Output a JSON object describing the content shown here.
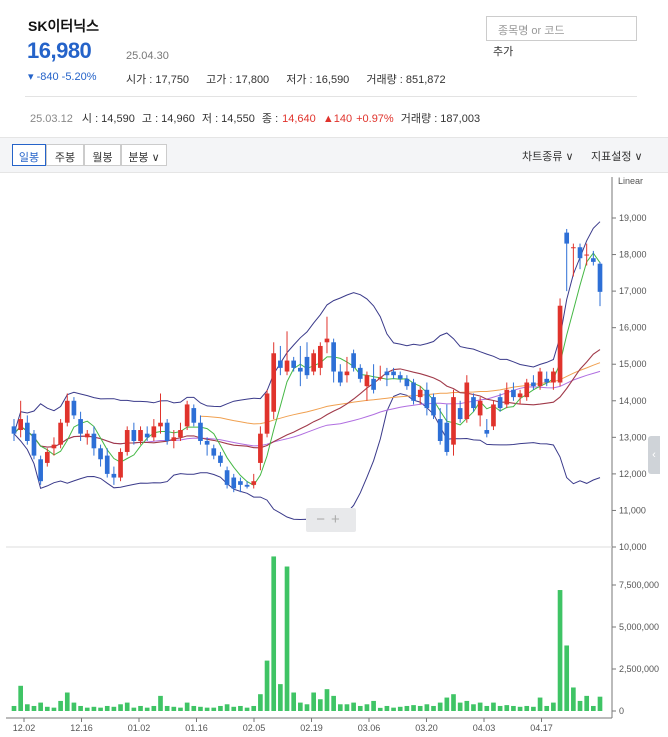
{
  "stock": {
    "name": "SK이터닉스",
    "price": "16,980",
    "change": "▾ -840  -5.20%",
    "date": "25.04.30",
    "open": "시가 : 17,750",
    "high": "고가 : 17,800",
    "low": "저가 : 16,590",
    "volume": "거래량 : 851,872"
  },
  "search": {
    "placeholder": "종목명 or 코드",
    "add_label": "추가"
  },
  "selected_day": {
    "date": "25.03.12",
    "open": "시 : 14,590",
    "high": "고 : 14,960",
    "low": "저 : 14,550",
    "close_label": "종 :",
    "close": "14,640",
    "change": "▲140",
    "change_pct": "+0.97%",
    "volume": "거래량 : 187,003"
  },
  "toolbar": {
    "tabs": [
      "일봉",
      "주봉",
      "월봉",
      "분봉 ∨"
    ],
    "chart_type": "차트종류 ∨",
    "indicators": "지표설정 ∨"
  },
  "colors": {
    "up": "#e0332c",
    "down": "#2d6fd6",
    "volume": "#3fc465",
    "bollinger": "#3a3a8a",
    "ma_short": "#45b845",
    "ma_mid": "#a03a4a",
    "ma_long": "#b06ee0",
    "ma_longest": "#f0a050"
  },
  "chart_data": {
    "type": "candlestick",
    "price_scale": "Linear",
    "y_ticks": [
      "19,000",
      "18,000",
      "17,000",
      "16,000",
      "15,000",
      "14,000",
      "13,000",
      "12,000",
      "11,000",
      "10,000"
    ],
    "volume_ticks": [
      "7,500,000",
      "5,000,000",
      "2,500,000",
      "0"
    ],
    "x_ticks": [
      "12.02",
      "12.16",
      "01.02",
      "01.16",
      "02.05",
      "02.19",
      "03.06",
      "03.20",
      "04.03",
      "04.17"
    ],
    "ylim": [
      10000,
      19500
    ],
    "candles": [
      {
        "o": 13300,
        "h": 13500,
        "l": 12900,
        "c": 13100,
        "v": 300000
      },
      {
        "o": 13200,
        "h": 14000,
        "l": 13000,
        "c": 13500,
        "v": 1500000
      },
      {
        "o": 13400,
        "h": 13600,
        "l": 12800,
        "c": 12900,
        "v": 400000
      },
      {
        "o": 13100,
        "h": 13200,
        "l": 12400,
        "c": 12500,
        "v": 300000
      },
      {
        "o": 12400,
        "h": 12500,
        "l": 11700,
        "c": 11800,
        "v": 500000
      },
      {
        "o": 12300,
        "h": 12700,
        "l": 12200,
        "c": 12600,
        "v": 250000
      },
      {
        "o": 12700,
        "h": 13000,
        "l": 12500,
        "c": 12800,
        "v": 200000
      },
      {
        "o": 12800,
        "h": 13500,
        "l": 12700,
        "c": 13400,
        "v": 600000
      },
      {
        "o": 13400,
        "h": 14200,
        "l": 13300,
        "c": 14000,
        "v": 1100000
      },
      {
        "o": 14000,
        "h": 14100,
        "l": 13500,
        "c": 13600,
        "v": 500000
      },
      {
        "o": 13500,
        "h": 13700,
        "l": 12900,
        "c": 13100,
        "v": 300000
      },
      {
        "o": 13000,
        "h": 13200,
        "l": 12800,
        "c": 13100,
        "v": 200000
      },
      {
        "o": 13100,
        "h": 13300,
        "l": 12500,
        "c": 12700,
        "v": 250000
      },
      {
        "o": 12700,
        "h": 12800,
        "l": 12200,
        "c": 12400,
        "v": 200000
      },
      {
        "o": 12500,
        "h": 12700,
        "l": 11900,
        "c": 12000,
        "v": 300000
      },
      {
        "o": 12000,
        "h": 12200,
        "l": 11700,
        "c": 11900,
        "v": 250000
      },
      {
        "o": 11900,
        "h": 12700,
        "l": 11800,
        "c": 12600,
        "v": 400000
      },
      {
        "o": 12600,
        "h": 13300,
        "l": 12500,
        "c": 13200,
        "v": 500000
      },
      {
        "o": 13200,
        "h": 13400,
        "l": 12800,
        "c": 12900,
        "v": 200000
      },
      {
        "o": 12900,
        "h": 13300,
        "l": 12800,
        "c": 13200,
        "v": 300000
      },
      {
        "o": 13100,
        "h": 13300,
        "l": 12900,
        "c": 13000,
        "v": 200000
      },
      {
        "o": 13000,
        "h": 13500,
        "l": 12900,
        "c": 13300,
        "v": 300000
      },
      {
        "o": 13300,
        "h": 14200,
        "l": 13100,
        "c": 13400,
        "v": 900000
      },
      {
        "o": 13400,
        "h": 13500,
        "l": 12800,
        "c": 12900,
        "v": 300000
      },
      {
        "o": 12900,
        "h": 13200,
        "l": 12700,
        "c": 13000,
        "v": 250000
      },
      {
        "o": 13000,
        "h": 13400,
        "l": 12900,
        "c": 13200,
        "v": 200000
      },
      {
        "o": 13300,
        "h": 14000,
        "l": 13200,
        "c": 13900,
        "v": 500000
      },
      {
        "o": 13800,
        "h": 13900,
        "l": 13300,
        "c": 13400,
        "v": 300000
      },
      {
        "o": 13400,
        "h": 13600,
        "l": 12800,
        "c": 12900,
        "v": 250000
      },
      {
        "o": 12900,
        "h": 13000,
        "l": 12500,
        "c": 12800,
        "v": 200000
      },
      {
        "o": 12700,
        "h": 12800,
        "l": 12400,
        "c": 12500,
        "v": 200000
      },
      {
        "o": 12500,
        "h": 12600,
        "l": 12200,
        "c": 12300,
        "v": 300000
      },
      {
        "o": 12100,
        "h": 12200,
        "l": 11600,
        "c": 11700,
        "v": 400000
      },
      {
        "o": 11900,
        "h": 12000,
        "l": 11500,
        "c": 11600,
        "v": 250000
      },
      {
        "o": 11800,
        "h": 11900,
        "l": 11500,
        "c": 11700,
        "v": 300000
      },
      {
        "o": 11700,
        "h": 11800,
        "l": 11600,
        "c": 11650,
        "v": 200000
      },
      {
        "o": 11700,
        "h": 12000,
        "l": 11600,
        "c": 11800,
        "v": 300000
      },
      {
        "o": 12300,
        "h": 13300,
        "l": 12100,
        "c": 13100,
        "v": 1000000
      },
      {
        "o": 13100,
        "h": 14300,
        "l": 13000,
        "c": 14200,
        "v": 3000000
      },
      {
        "o": 13700,
        "h": 15600,
        "l": 13500,
        "c": 15300,
        "v": 9200000
      },
      {
        "o": 15100,
        "h": 15500,
        "l": 14700,
        "c": 14900,
        "v": 1600000
      },
      {
        "o": 14800,
        "h": 15900,
        "l": 14700,
        "c": 15100,
        "v": 8600000
      },
      {
        "o": 15100,
        "h": 15200,
        "l": 14800,
        "c": 14900,
        "v": 1100000
      },
      {
        "o": 14900,
        "h": 15500,
        "l": 14400,
        "c": 14800,
        "v": 500000
      },
      {
        "o": 15200,
        "h": 15600,
        "l": 14600,
        "c": 14700,
        "v": 400000
      },
      {
        "o": 14800,
        "h": 15400,
        "l": 14700,
        "c": 15300,
        "v": 1100000
      },
      {
        "o": 14900,
        "h": 15600,
        "l": 14700,
        "c": 15500,
        "v": 700000
      },
      {
        "o": 15600,
        "h": 16300,
        "l": 15300,
        "c": 15700,
        "v": 1300000
      },
      {
        "o": 15600,
        "h": 15700,
        "l": 14500,
        "c": 14800,
        "v": 900000
      },
      {
        "o": 14800,
        "h": 15000,
        "l": 14400,
        "c": 14500,
        "v": 400000
      },
      {
        "o": 14700,
        "h": 15200,
        "l": 14500,
        "c": 14800,
        "v": 400000
      },
      {
        "o": 15300,
        "h": 15400,
        "l": 14800,
        "c": 14900,
        "v": 500000
      },
      {
        "o": 14900,
        "h": 15000,
        "l": 14500,
        "c": 14600,
        "v": 300000
      },
      {
        "o": 14400,
        "h": 14800,
        "l": 14000,
        "c": 14700,
        "v": 400000
      },
      {
        "o": 14600,
        "h": 15000,
        "l": 14200,
        "c": 14300,
        "v": 600000
      },
      {
        "o": 14600,
        "h": 14960,
        "l": 14550,
        "c": 14640,
        "v": 187003
      },
      {
        "o": 14800,
        "h": 14900,
        "l": 14400,
        "c": 14700,
        "v": 300000
      },
      {
        "o": 14800,
        "h": 14900,
        "l": 14600,
        "c": 14700,
        "v": 200000
      },
      {
        "o": 14700,
        "h": 14800,
        "l": 14500,
        "c": 14600,
        "v": 250000
      },
      {
        "o": 14600,
        "h": 14700,
        "l": 14300,
        "c": 14400,
        "v": 300000
      },
      {
        "o": 14500,
        "h": 14600,
        "l": 13900,
        "c": 14000,
        "v": 350000
      },
      {
        "o": 14100,
        "h": 14400,
        "l": 13900,
        "c": 14300,
        "v": 300000
      },
      {
        "o": 14300,
        "h": 14500,
        "l": 13600,
        "c": 13800,
        "v": 400000
      },
      {
        "o": 14100,
        "h": 14200,
        "l": 13500,
        "c": 13600,
        "v": 300000
      },
      {
        "o": 13500,
        "h": 13800,
        "l": 12800,
        "c": 12900,
        "v": 500000
      },
      {
        "o": 13400,
        "h": 13900,
        "l": 12500,
        "c": 12600,
        "v": 800000
      },
      {
        "o": 12800,
        "h": 14300,
        "l": 12500,
        "c": 14100,
        "v": 1000000
      },
      {
        "o": 13800,
        "h": 14000,
        "l": 13400,
        "c": 13500,
        "v": 500000
      },
      {
        "o": 13500,
        "h": 14700,
        "l": 13400,
        "c": 14500,
        "v": 600000
      },
      {
        "o": 14100,
        "h": 14200,
        "l": 13700,
        "c": 13800,
        "v": 400000
      },
      {
        "o": 13600,
        "h": 14100,
        "l": 13300,
        "c": 14000,
        "v": 500000
      },
      {
        "o": 13200,
        "h": 13500,
        "l": 13000,
        "c": 13100,
        "v": 300000
      },
      {
        "o": 13300,
        "h": 14000,
        "l": 13200,
        "c": 13900,
        "v": 500000
      },
      {
        "o": 14100,
        "h": 14200,
        "l": 13700,
        "c": 13800,
        "v": 300000
      },
      {
        "o": 13900,
        "h": 14500,
        "l": 13800,
        "c": 14300,
        "v": 350000
      },
      {
        "o": 14300,
        "h": 14500,
        "l": 14000,
        "c": 14100,
        "v": 300000
      },
      {
        "o": 14100,
        "h": 14300,
        "l": 13900,
        "c": 14200,
        "v": 250000
      },
      {
        "o": 14100,
        "h": 14600,
        "l": 14000,
        "c": 14500,
        "v": 300000
      },
      {
        "o": 14500,
        "h": 14700,
        "l": 14300,
        "c": 14400,
        "v": 250000
      },
      {
        "o": 14400,
        "h": 14900,
        "l": 14300,
        "c": 14800,
        "v": 800000
      },
      {
        "o": 14600,
        "h": 14800,
        "l": 14400,
        "c": 14500,
        "v": 300000
      },
      {
        "o": 14500,
        "h": 14900,
        "l": 14300,
        "c": 14800,
        "v": 500000
      },
      {
        "o": 14500,
        "h": 16800,
        "l": 14400,
        "c": 16600,
        "v": 7200000
      },
      {
        "o": 18600,
        "h": 18700,
        "l": 17000,
        "c": 18300,
        "v": 3900000
      },
      {
        "o": 18200,
        "h": 18300,
        "l": 17400,
        "c": 18200,
        "v": 1400000
      },
      {
        "o": 18200,
        "h": 18300,
        "l": 17600,
        "c": 17900,
        "v": 600000
      },
      {
        "o": 18000,
        "h": 18300,
        "l": 17700,
        "c": 18000,
        "v": 900000
      },
      {
        "o": 17900,
        "h": 18100,
        "l": 17700,
        "c": 17800,
        "v": 300000
      },
      {
        "o": 17750,
        "h": 17800,
        "l": 16590,
        "c": 16980,
        "v": 851872
      }
    ]
  }
}
